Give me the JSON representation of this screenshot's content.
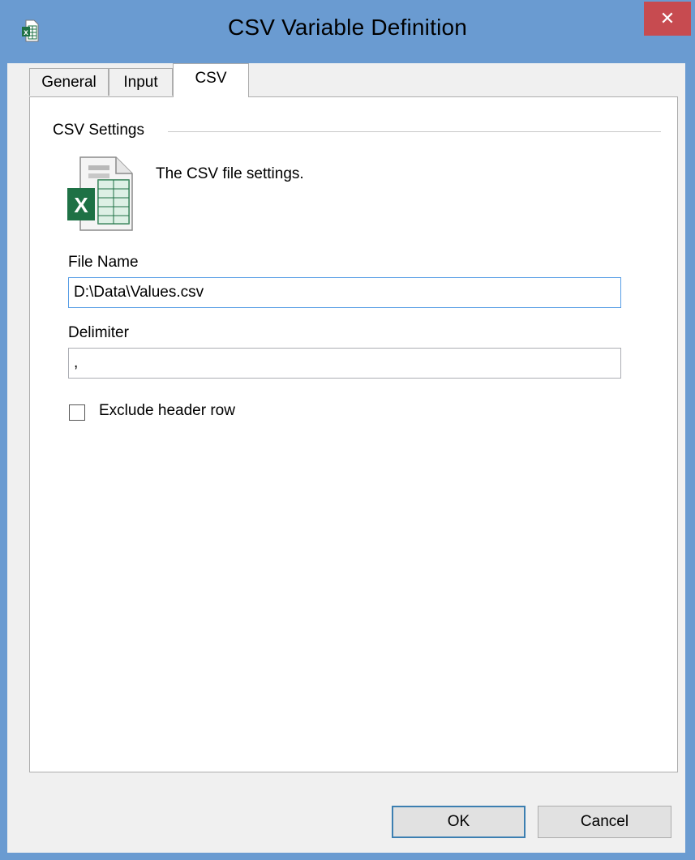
{
  "window": {
    "title": "CSV Variable Definition",
    "close_glyph": "✕",
    "app_icon": "excel-file-icon"
  },
  "tabs": [
    {
      "label": "General",
      "active": false
    },
    {
      "label": "Input",
      "active": false
    },
    {
      "label": "CSV",
      "active": true
    }
  ],
  "csv_settings": {
    "group_label": "CSV Settings",
    "icon": "csv-file-icon",
    "description": "The CSV file settings.",
    "file_name": {
      "label": "File Name",
      "value": "D:\\Data\\Values.csv"
    },
    "delimiter": {
      "label": "Delimiter",
      "value": ","
    },
    "exclude_header": {
      "label": "Exclude header row",
      "checked": false
    }
  },
  "buttons": {
    "ok": "OK",
    "cancel": "Cancel"
  },
  "colors": {
    "titlebar": "#6a9bd1",
    "close": "#c74b50",
    "excel_green": "#1e7145",
    "focus_border": "#569de5"
  }
}
